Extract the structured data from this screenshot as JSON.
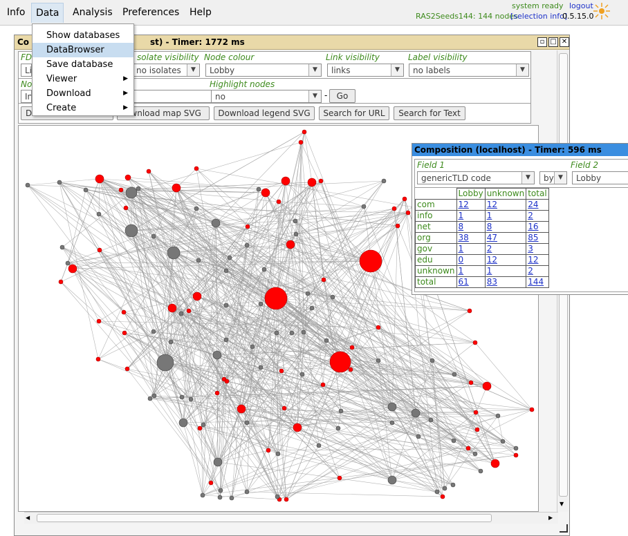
{
  "menubar": {
    "items": [
      {
        "label": "Info"
      },
      {
        "label": "Data"
      },
      {
        "label": "Analysis"
      },
      {
        "label": "Preferences"
      },
      {
        "label": "Help"
      }
    ],
    "status": "system ready",
    "logout": "logout",
    "db_info": "RAS2Seeds144: 144 nodes",
    "selection_info": "[selection info]",
    "version": "0.5.15.0"
  },
  "data_menu": {
    "items": [
      {
        "label": "Show databases",
        "submenu": false
      },
      {
        "label": "DataBrowser",
        "submenu": false,
        "selected": true
      },
      {
        "label": "Save database",
        "submenu": false
      },
      {
        "label": "Viewer",
        "submenu": true
      },
      {
        "label": "Download",
        "submenu": true
      },
      {
        "label": "Create",
        "submenu": true
      }
    ],
    "submenu_arrow": "▶"
  },
  "main_window": {
    "title_left": "Co",
    "title_right": "st) - Timer: 1772 ms",
    "controls": {
      "fd_label": "FD",
      "fd_value": "Li",
      "isolate_label": "solate visibility",
      "isolate_value": "no isolates",
      "node_colour_label": "Node colour",
      "node_colour_value": "Lobby",
      "link_visibility_label": "Link visibility",
      "link_visibility_value": "links",
      "label_visibility_label": "Label visibility",
      "label_visibility_value": "no labels",
      "no_label": "No",
      "no_value": "In",
      "highlight_label": "Highlight nodes",
      "highlight_value": "no",
      "dash": "-",
      "go_button": "Go",
      "btn_first": "D",
      "download_map": "ownload map SVG",
      "download_legend": "Download legend SVG",
      "search_url": "Search for URL",
      "search_text": "Search for Text"
    }
  },
  "composition": {
    "title": "Composition (localhost) - Timer: 596 ms",
    "field1_label": "Field 1",
    "field1_value": "genericTLD code",
    "by_value": "by",
    "field2_label": "Field 2",
    "field2_value": "Lobby",
    "columns": [
      "Lobby",
      "unknown",
      "total"
    ],
    "rows": [
      {
        "label": "com",
        "values": [
          "12",
          "12",
          "24"
        ]
      },
      {
        "label": "info",
        "values": [
          "1",
          "1",
          "2"
        ]
      },
      {
        "label": "net",
        "values": [
          "8",
          "8",
          "16"
        ]
      },
      {
        "label": "org",
        "values": [
          "38",
          "47",
          "85"
        ]
      },
      {
        "label": "gov",
        "values": [
          "1",
          "2",
          "3"
        ]
      },
      {
        "label": "edu",
        "values": [
          "0",
          "12",
          "12"
        ]
      },
      {
        "label": "unknown",
        "values": [
          "1",
          "1",
          "2"
        ]
      },
      {
        "label": "total",
        "values": [
          "61",
          "83",
          "144"
        ]
      }
    ]
  },
  "colors": {
    "lobby_node": "#ff0000",
    "unknown_node": "#777777",
    "edge": "#9a9a9a",
    "comp_title_bg": "#3b8ee0",
    "window_title_bg": "#e9d9a8",
    "label_green": "#3d8a1c",
    "link_blue": "#1d31c8"
  }
}
